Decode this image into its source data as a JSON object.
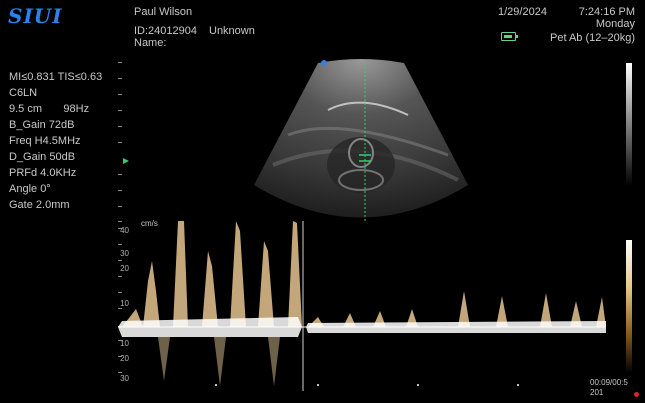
{
  "brand": {
    "logo": "SIUI"
  },
  "patient": {
    "name": "Paul Wilson",
    "id": "ID:24012904",
    "status": "Unknown",
    "name_label": "Name:"
  },
  "datetime": {
    "date": "1/29/2024",
    "time": "7:24:16 PM",
    "day": "Monday"
  },
  "preset": "Pet Ab (12–20kg)",
  "params": {
    "mi_tis": "MI≤0.831  TIS≤0.63",
    "probe": "C6LN",
    "depth_fps": "9.5 cm       98Hz",
    "b_gain": "B_Gain 72dB",
    "freq": "Freq H4.5MHz",
    "d_gain": "D_Gain 50dB",
    "prf": "PRFd 4.0KHz",
    "angle": "Angle 0°",
    "gate": "Gate 2.0mm"
  },
  "doppler": {
    "unit": "cm/s",
    "scale_labels": [
      "40",
      "30",
      "20",
      "10",
      "10",
      "20",
      "30"
    ],
    "elapsed": "00:09/00:5",
    "frame": "201"
  },
  "colors": {
    "logo": "#2a83e8",
    "gate_line": "#2fd070",
    "battery": "#5fd48a",
    "dot": "#3b7fd9",
    "record": "#e02020"
  },
  "icons": [
    "battery-icon",
    "sector-orientation-icon",
    "gate-marker-icon",
    "record-icon"
  ]
}
